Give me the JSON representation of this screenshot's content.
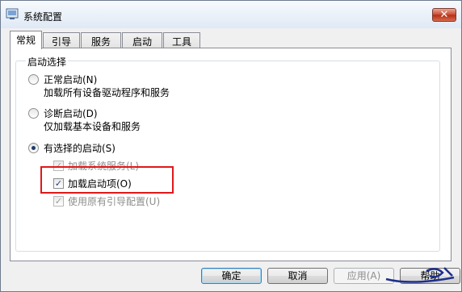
{
  "window": {
    "title": "系统配置",
    "close_label": "✕"
  },
  "tabs": [
    {
      "label": "常规",
      "active": true
    },
    {
      "label": "引导",
      "active": false
    },
    {
      "label": "服务",
      "active": false
    },
    {
      "label": "启动",
      "active": false
    },
    {
      "label": "工具",
      "active": false
    }
  ],
  "startup_group": {
    "title": "启动选择",
    "normal": {
      "label": "正常启动(N)",
      "desc": "加载所有设备驱动程序和服务",
      "selected": false
    },
    "diagnostic": {
      "label": "诊断启动(D)",
      "desc": "仅加载基本设备和服务",
      "selected": false
    },
    "selective": {
      "label": "有选择的启动(S)",
      "selected": true,
      "options": {
        "load_system_services": {
          "label": "加载系统服务(L)",
          "checked": true,
          "enabled": false
        },
        "load_startup_items": {
          "label": "加载启动项(O)",
          "checked": true,
          "enabled": true
        },
        "use_original_boot": {
          "label": "使用原有引导配置(U)",
          "checked": true,
          "enabled": false
        }
      }
    }
  },
  "buttons": {
    "ok": "确定",
    "cancel": "取消",
    "apply": "应用(A)",
    "help": "帮助"
  },
  "colors": {
    "highlight_border": "#e01818",
    "accent": "#3c7fb1"
  }
}
